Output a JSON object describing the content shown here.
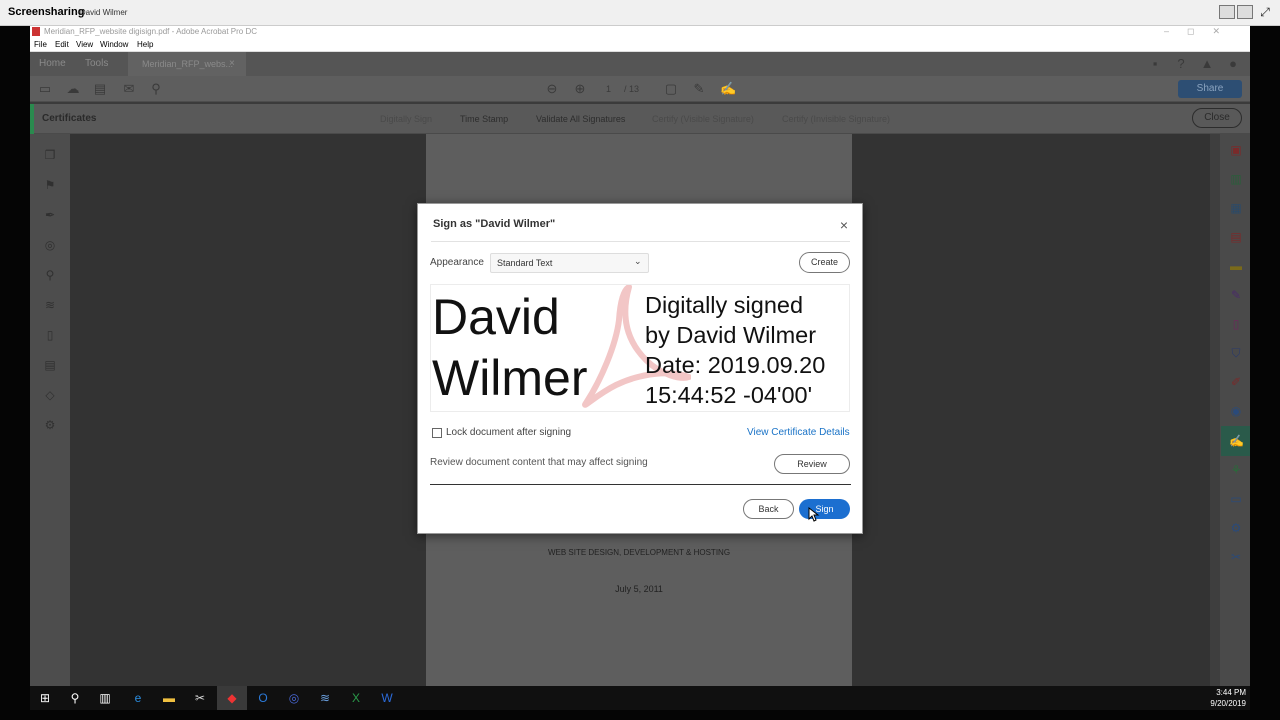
{
  "screensharing": {
    "title": "Screensharing",
    "presenter": "- David Wilmer"
  },
  "acrobat": {
    "window_title": "Meridian_RFP_website digisign.pdf - Adobe Acrobat Pro DC",
    "menu": [
      "File",
      "Edit",
      "View",
      "Window",
      "Help"
    ],
    "tabs": {
      "home": "Home",
      "tools": "Tools",
      "document": "Meridian_RFP_webs...",
      "document_close": "×"
    },
    "page_nav": {
      "current": "1",
      "total": "/ 13"
    },
    "share_label": "Share",
    "certificates_label": "Certificates",
    "cert_tools": {
      "digitally_sign": "Digitally Sign",
      "time_stamp": "Time Stamp",
      "validate_all": "Validate All Signatures",
      "certify_visible": "Certify (Visible Signature)",
      "certify_invisible": "Certify (Invisible Signature)"
    },
    "close_label": "Close",
    "page_text": {
      "line1": "WEB SITE DESIGN, DEVELOPMENT & HOSTING",
      "line2": "July 5, 2011"
    }
  },
  "dialog": {
    "title": "Sign as \"David Wilmer\"",
    "appearance_label": "Appearance",
    "appearance_value": "Standard Text",
    "create_label": "Create",
    "preview": {
      "name_line1": "David",
      "name_line2": "Wilmer",
      "detail_line1": "Digitally signed",
      "detail_line2": "by David Wilmer",
      "detail_line3": "Date: 2019.09.20",
      "detail_line4": "15:44:52 -04'00'"
    },
    "lock_label": "Lock document after signing",
    "lock_checked": false,
    "view_certificate_label": "View Certificate Details",
    "review_text": "Review document content that may affect signing",
    "review_label": "Review",
    "back_label": "Back",
    "sign_label": "Sign"
  },
  "taskbar": {
    "time": "3:44 PM",
    "date": "9/20/2019"
  },
  "colors": {
    "accent_blue": "#1c6fd0",
    "link_blue": "#1a73c7",
    "cert_green": "#2a8a4e",
    "adobe_red": "#c33"
  }
}
